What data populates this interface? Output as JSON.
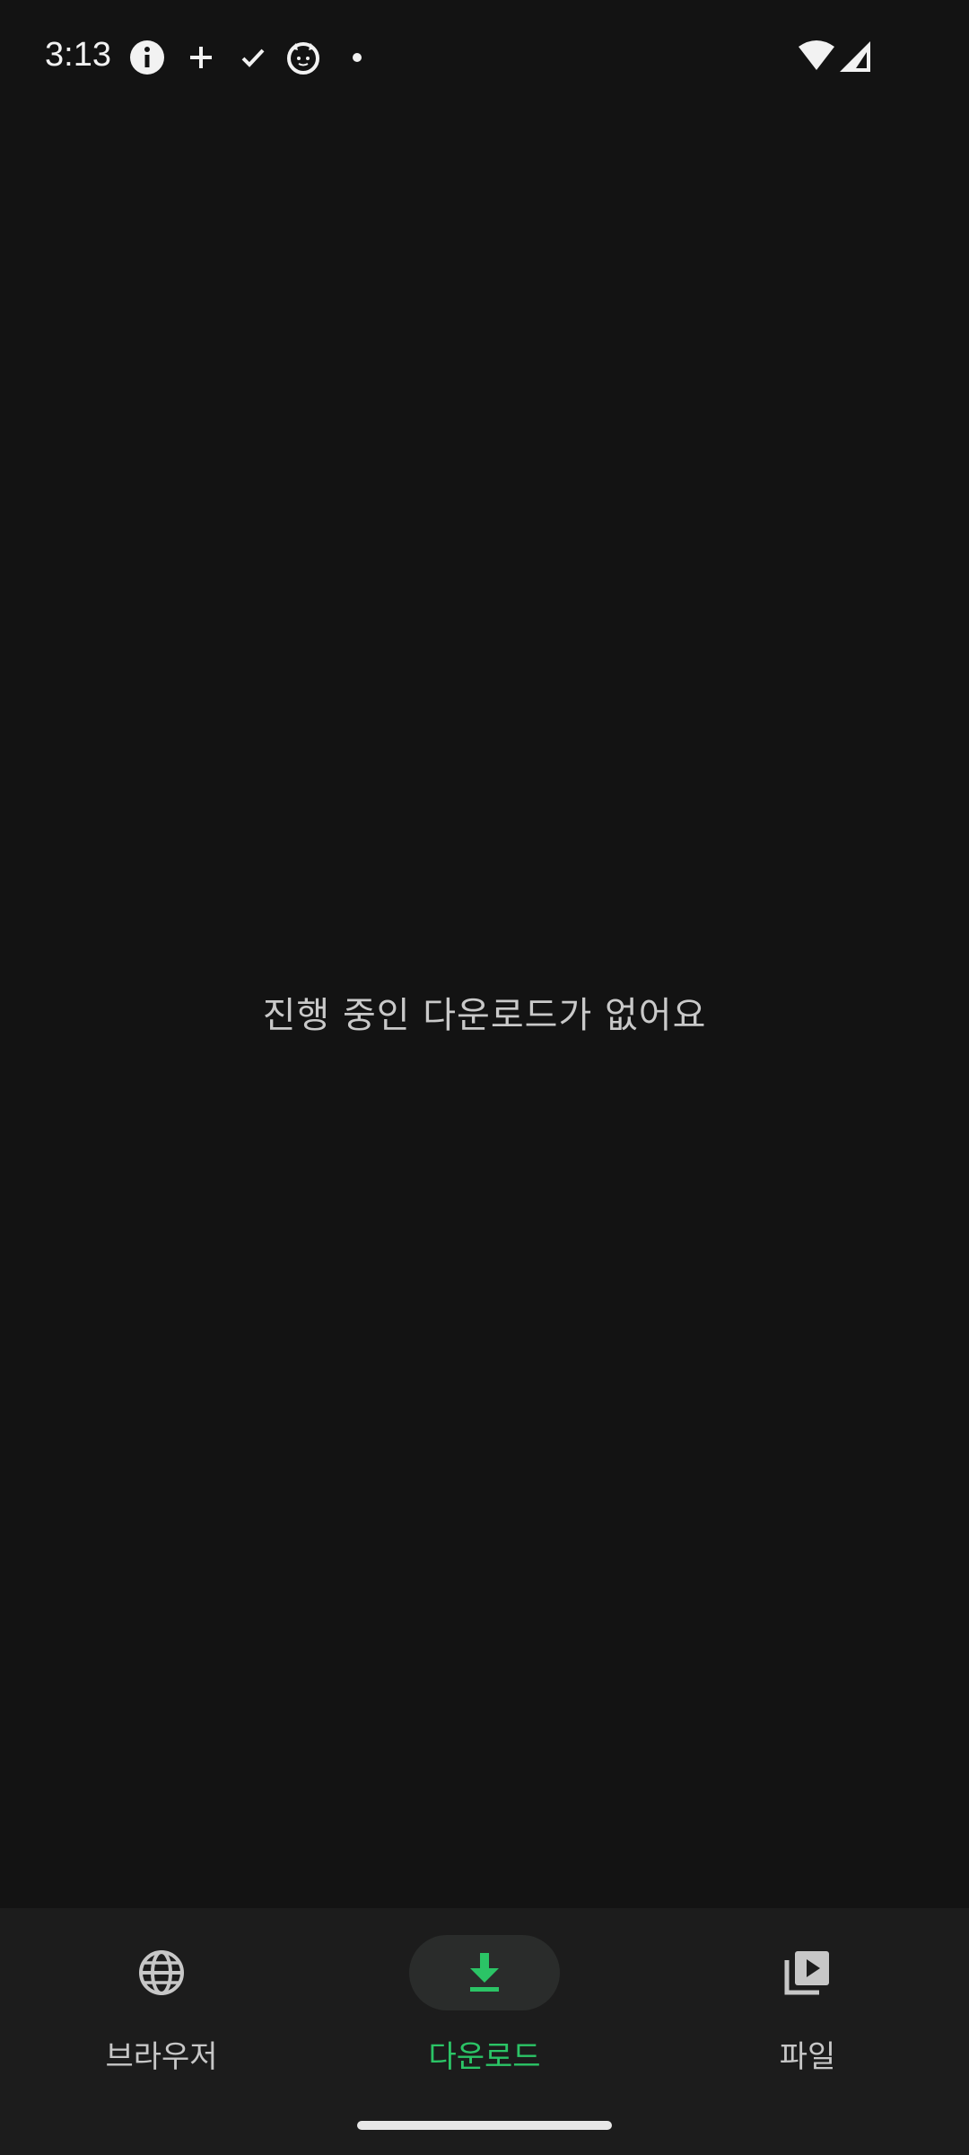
{
  "status_bar": {
    "time": "3:13",
    "icons": [
      "info-icon",
      "plus-icon",
      "check-icon",
      "cat-face-icon",
      "dot-icon",
      "wifi-icon",
      "signal-icon"
    ]
  },
  "main": {
    "empty_message": "진행 중인 다운로드가 없어요"
  },
  "bottom_nav": {
    "items": [
      {
        "label": "브라우저",
        "icon": "globe-icon",
        "active": false
      },
      {
        "label": "다운로드",
        "icon": "download-icon",
        "active": true
      },
      {
        "label": "파일",
        "icon": "video-library-icon",
        "active": false
      }
    ]
  },
  "colors": {
    "background": "#131313",
    "nav_background": "#1c1c1c",
    "accent": "#2bc466",
    "text_secondary": "#c9c9c9"
  }
}
